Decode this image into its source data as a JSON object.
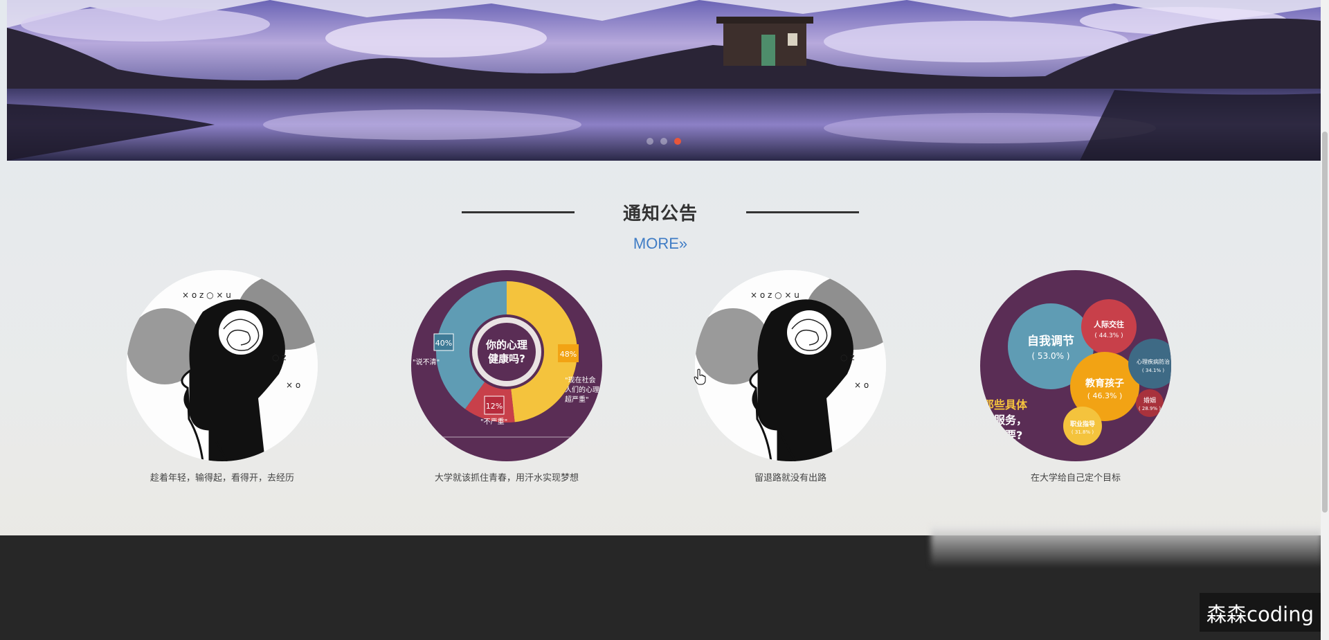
{
  "banner": {
    "slide_count": 3,
    "active_slide": 2
  },
  "notice": {
    "title": "通知公告",
    "more_label": "MORE»"
  },
  "cards": [
    {
      "caption": "趁着年轻，输得起，看得开，去经历",
      "image": "head-thought-illustration"
    },
    {
      "caption": "大学就该抓住青春，用汗水实现梦想",
      "image": "mental-health-donut-infographic"
    },
    {
      "caption": "留退路就没有出路",
      "image": "head-thought-illustration"
    },
    {
      "caption": "在大学给自己定个目标",
      "image": "psych-service-bubble-infographic"
    }
  ],
  "infographic1": {
    "center_text_line1": "你的心理",
    "center_text_line2": "健康吗?",
    "pct_left": "40%",
    "pct_right": "48%",
    "pct_bottom": "12%",
    "quote_left": "\"说不清\"",
    "quote_bottom": "\"不严重\"",
    "quote_right_1": "\"现在社会",
    "quote_right_2": "人们的心理",
    "quote_right_3": "超严重\""
  },
  "infographic2": {
    "b1_label": "自我调节",
    "b1_pct": "( 53.0% )",
    "b2_label": "人际交往",
    "b2_pct": "( 44.3% )",
    "b3_label": "教育孩子",
    "b3_pct": "( 46.3% )",
    "b4_label": "心理疾病防治",
    "b4_pct": "( 34.1% )",
    "b5_label": "婚姻",
    "b5_pct": "( 28.9% )",
    "b6_label": "职业指导",
    "b6_pct": "( 31.8% )",
    "side_text_1": "那些具体",
    "side_text_2": "理服务，",
    "side_text_3": "需要?"
  },
  "watermark": "森森coding",
  "colors": {
    "accent": "#3f7cc5",
    "dot_active": "#e8563a",
    "footer": "#272727"
  }
}
